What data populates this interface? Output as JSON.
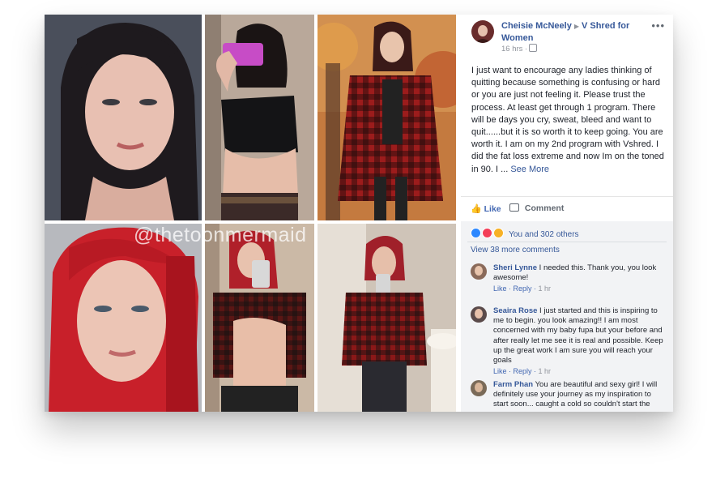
{
  "watermark": "@thetoonmermaid",
  "post": {
    "author": "Cheisie McNeely",
    "group": "V Shred for Women",
    "time": "16 hrs ·",
    "more": "•••",
    "text": "I just want to encourage any ladies thinking of quitting because something is confusing or hard or you are just not feeling it. Please trust the process. At least get through 1 program. There will be days you cry, sweat, bleed and want to quit......but it is so worth it to keep going. You are worth it. I am on my 2nd program with Vshred. I did the fat loss extreme and now Im on the toned in 90. I ...",
    "see_more": "See More"
  },
  "actions": {
    "like": "Like",
    "comment": "Comment"
  },
  "reactions": {
    "text": "You and 302 others",
    "colors": [
      "#2d88ff",
      "#f33e58",
      "#f7b125"
    ]
  },
  "view_more_comments": "View 38 more comments",
  "comments": [
    {
      "name": "Sheri Lynne",
      "text": "I needed this. Thank you, you look awesome!",
      "like": "Like",
      "reply": "Reply",
      "time": "1 hr"
    },
    {
      "name": "Seaira Rose",
      "text": "I just started and this is inspiring to me to begin. you look amazing!! I am most concerned with my baby fupa but your before and after really let me see it is real and possible. Keep up the great work I am sure you will reach your goals",
      "like": "Like",
      "reply": "Reply",
      "time": "1 hr"
    },
    {
      "name": "Farm Phan",
      "text": "You are beautiful and sexy girl! I will definitely use your journey as my inspiration to start soon... caught a cold so couldn't start the",
      "like": "",
      "reply": "",
      "time": ""
    }
  ],
  "colors": {
    "link": "#365899",
    "like_blue": "#4267b2",
    "muted": "#90949c"
  }
}
